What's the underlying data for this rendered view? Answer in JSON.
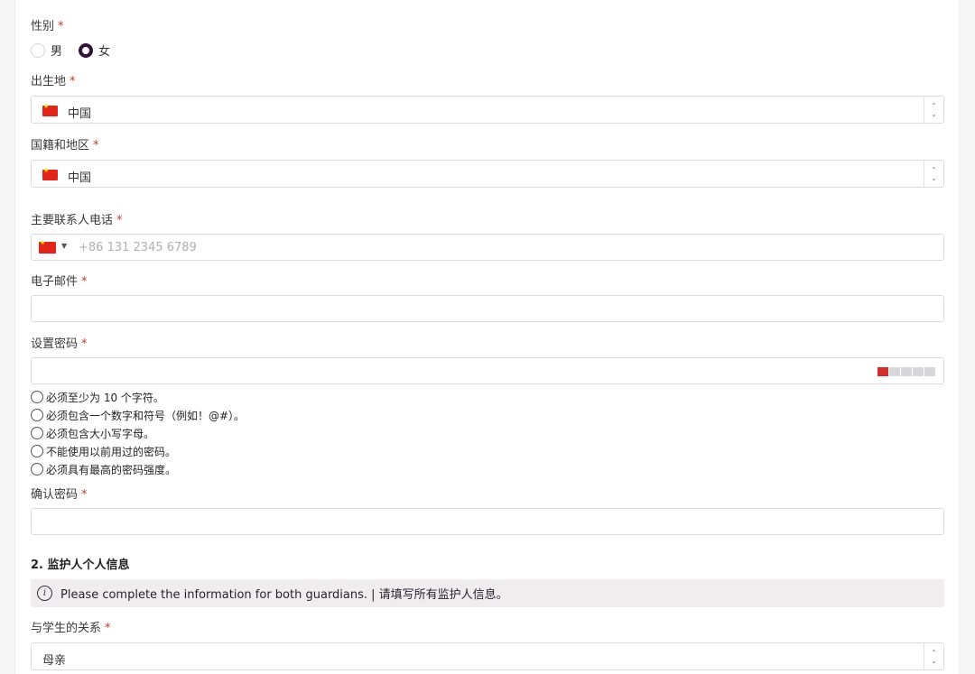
{
  "form": {
    "required_mark": "*",
    "gender": {
      "label": "性别",
      "options": [
        {
          "label": "男",
          "selected": false
        },
        {
          "label": "女",
          "selected": true
        }
      ]
    },
    "birthplace": {
      "label": "出生地",
      "value": "中国"
    },
    "nationality": {
      "label": "国籍和地区",
      "value": "中国"
    },
    "phone": {
      "label": "主要联系人电话",
      "placeholder": "+86 131 2345 6789",
      "country_icon": "china-flag-icon"
    },
    "email": {
      "label": "电子邮件",
      "value": ""
    },
    "password": {
      "label": "设置密码",
      "value": "",
      "strength_level": 1,
      "strength_segments": 5,
      "strength_color": "#d32f2f",
      "rules": [
        "必须至少为 10 个字符。",
        "必须包含一个数字和符号（例如！@#）。",
        "必须包含大小写字母。",
        "不能使用以前用过的密码。",
        "必须具有最高的密码强度。"
      ]
    },
    "confirm_password": {
      "label": "确认密码",
      "value": ""
    },
    "section2": {
      "title": "2.  监护人个人信息",
      "notice": "Please complete the information for both guardians. | 请填写所有监护人信息。"
    },
    "relationship": {
      "label": "与学生的关系",
      "value": "母亲"
    }
  },
  "colors": {
    "accent": "#2f1438",
    "required": "#c0392b",
    "notice_bg": "#f1ecee"
  }
}
